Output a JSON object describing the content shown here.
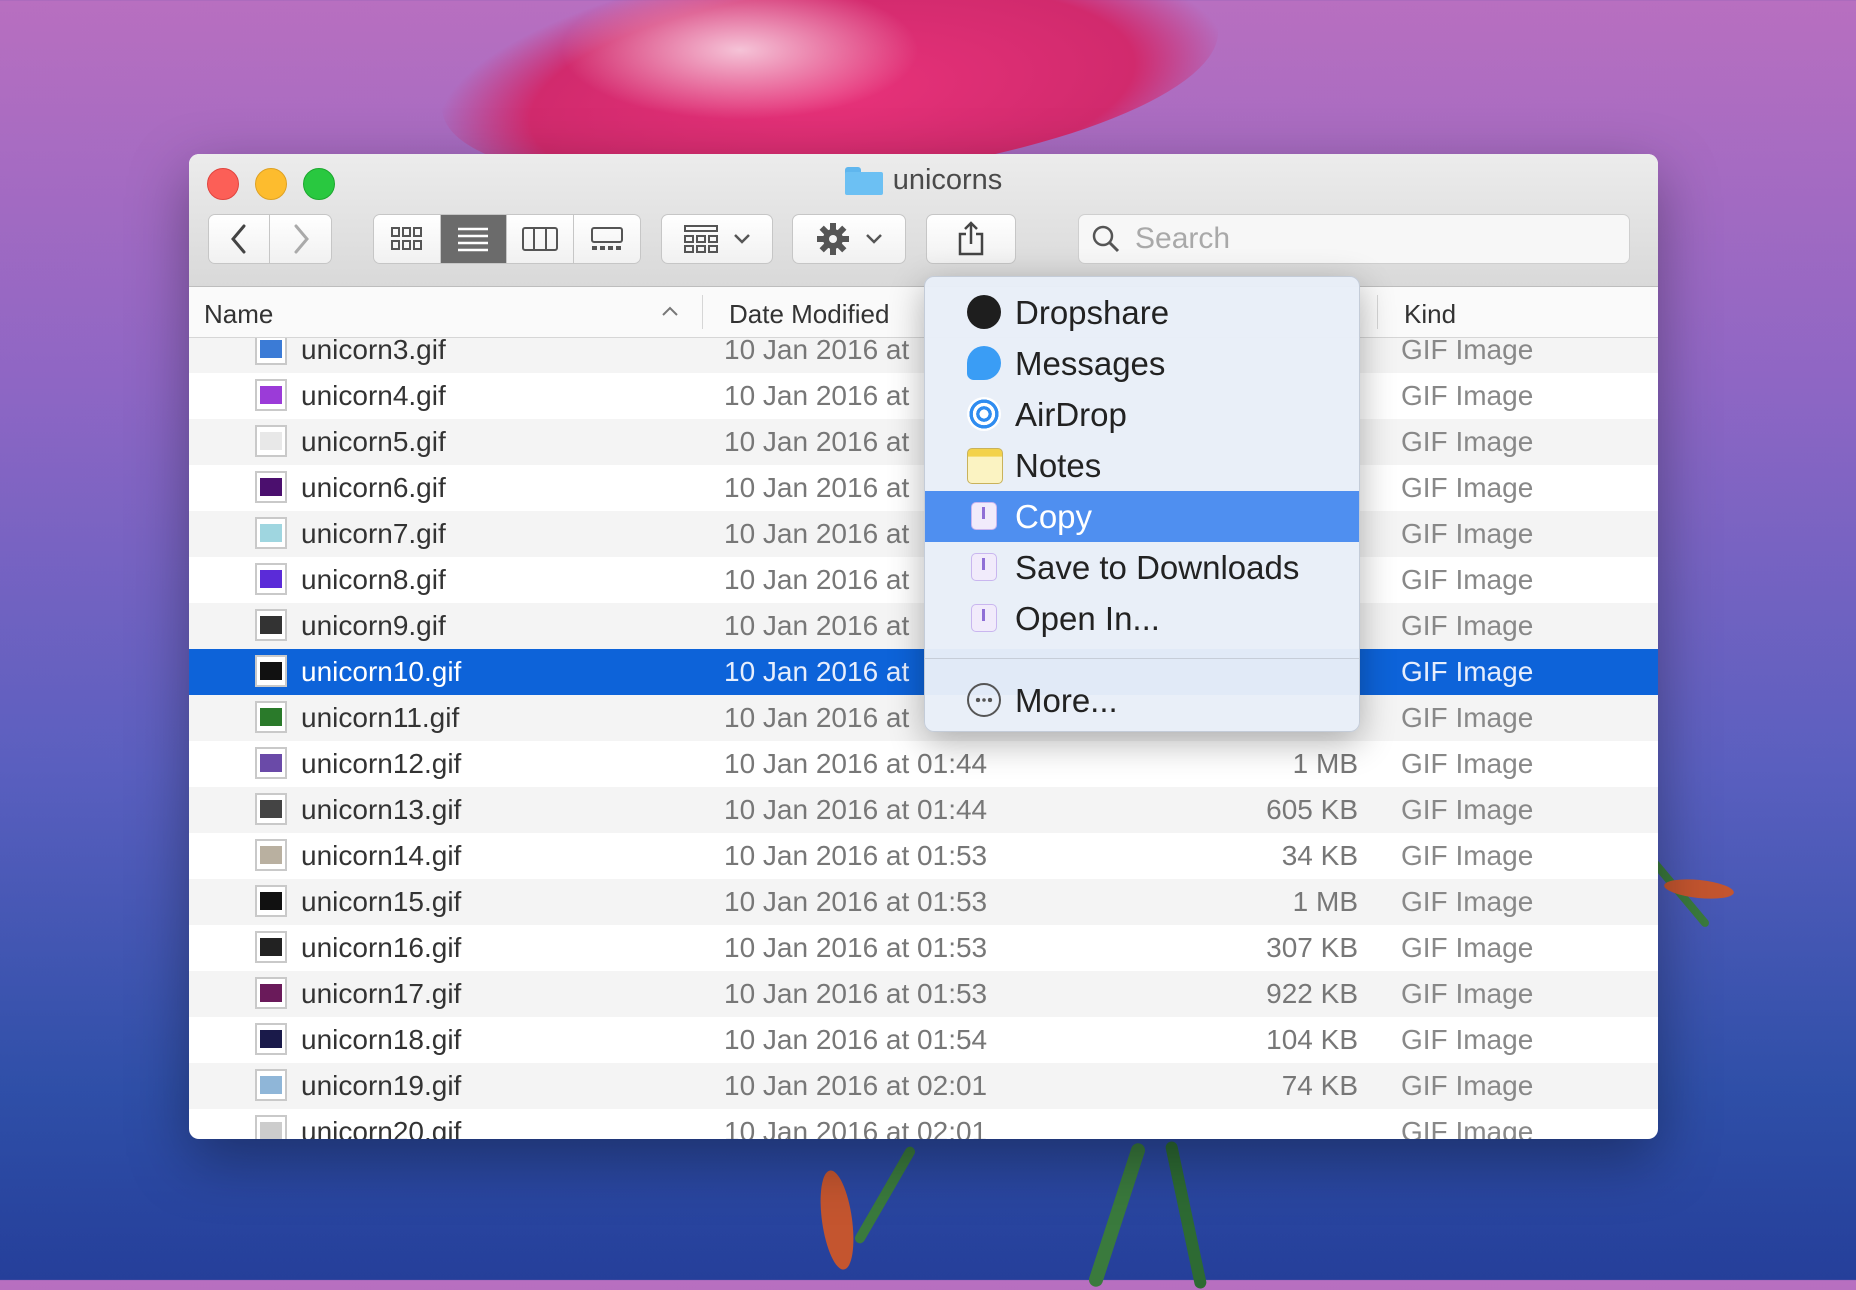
{
  "window": {
    "title": "unicorns"
  },
  "toolbar": {
    "back_icon": "chevron-left-icon",
    "forward_icon": "chevron-right-icon",
    "view_icons": [
      "icon-view-icon",
      "list-view-icon",
      "column-view-icon",
      "gallery-view-icon"
    ],
    "active_view": "list-view-icon",
    "group_icon": "group-by-icon",
    "action_icon": "gear-icon",
    "share_icon": "share-icon"
  },
  "search": {
    "placeholder": "Search"
  },
  "columns": {
    "name": "Name",
    "date": "Date Modified",
    "kind": "Kind"
  },
  "files": [
    {
      "name": "unicorn3.gif",
      "date": "10 Jan 2016 at",
      "size": "",
      "kind": "GIF Image"
    },
    {
      "name": "unicorn4.gif",
      "date": "10 Jan 2016 at",
      "size": "",
      "kind": "GIF Image"
    },
    {
      "name": "unicorn5.gif",
      "date": "10 Jan 2016 at",
      "size": "",
      "kind": "GIF Image"
    },
    {
      "name": "unicorn6.gif",
      "date": "10 Jan 2016 at",
      "size": "",
      "kind": "GIF Image"
    },
    {
      "name": "unicorn7.gif",
      "date": "10 Jan 2016 at",
      "size": "",
      "kind": "GIF Image"
    },
    {
      "name": "unicorn8.gif",
      "date": "10 Jan 2016 at",
      "size": "",
      "kind": "GIF Image"
    },
    {
      "name": "unicorn9.gif",
      "date": "10 Jan 2016 at",
      "size": "",
      "kind": "GIF Image"
    },
    {
      "name": "unicorn10.gif",
      "date": "10 Jan 2016 at",
      "size": "",
      "kind": "GIF Image"
    },
    {
      "name": "unicorn11.gif",
      "date": "10 Jan 2016 at",
      "size": "",
      "kind": "GIF Image"
    },
    {
      "name": "unicorn12.gif",
      "date": "10 Jan 2016 at 01:44",
      "size": "1 MB",
      "kind": "GIF Image"
    },
    {
      "name": "unicorn13.gif",
      "date": "10 Jan 2016 at 01:44",
      "size": "605 KB",
      "kind": "GIF Image"
    },
    {
      "name": "unicorn14.gif",
      "date": "10 Jan 2016 at 01:53",
      "size": "34 KB",
      "kind": "GIF Image"
    },
    {
      "name": "unicorn15.gif",
      "date": "10 Jan 2016 at 01:53",
      "size": "1 MB",
      "kind": "GIF Image"
    },
    {
      "name": "unicorn16.gif",
      "date": "10 Jan 2016 at 01:53",
      "size": "307 KB",
      "kind": "GIF Image"
    },
    {
      "name": "unicorn17.gif",
      "date": "10 Jan 2016 at 01:53",
      "size": "922 KB",
      "kind": "GIF Image"
    },
    {
      "name": "unicorn18.gif",
      "date": "10 Jan 2016 at 01:54",
      "size": "104 KB",
      "kind": "GIF Image"
    },
    {
      "name": "unicorn19.gif",
      "date": "10 Jan 2016 at 02:01",
      "size": "74 KB",
      "kind": "GIF Image"
    },
    {
      "name": "unicorn20.gif",
      "date": "10 Jan 2016 at 02:01",
      "size": "",
      "kind": "GIF Image"
    }
  ],
  "selected_file": "unicorn10.gif",
  "share_menu": {
    "items": [
      {
        "label": "Dropshare",
        "icon": "dropshare-icon",
        "color": "#222222"
      },
      {
        "label": "Messages",
        "icon": "messages-icon",
        "color": "#3a9df5"
      },
      {
        "label": "AirDrop",
        "icon": "airdrop-icon",
        "color": "#2f8cf0"
      },
      {
        "label": "Notes",
        "icon": "notes-icon",
        "color": "#f3d24b"
      },
      {
        "label": "Copy",
        "icon": "share-icon",
        "highlighted": true
      },
      {
        "label": "Save to Downloads",
        "icon": "share-icon"
      },
      {
        "label": "Open In...",
        "icon": "share-icon"
      }
    ],
    "more": {
      "label": "More...",
      "icon": "more-icon"
    }
  },
  "colors": {
    "selection": "#0d63d9",
    "menu_highlight": "#4f8ff0"
  }
}
